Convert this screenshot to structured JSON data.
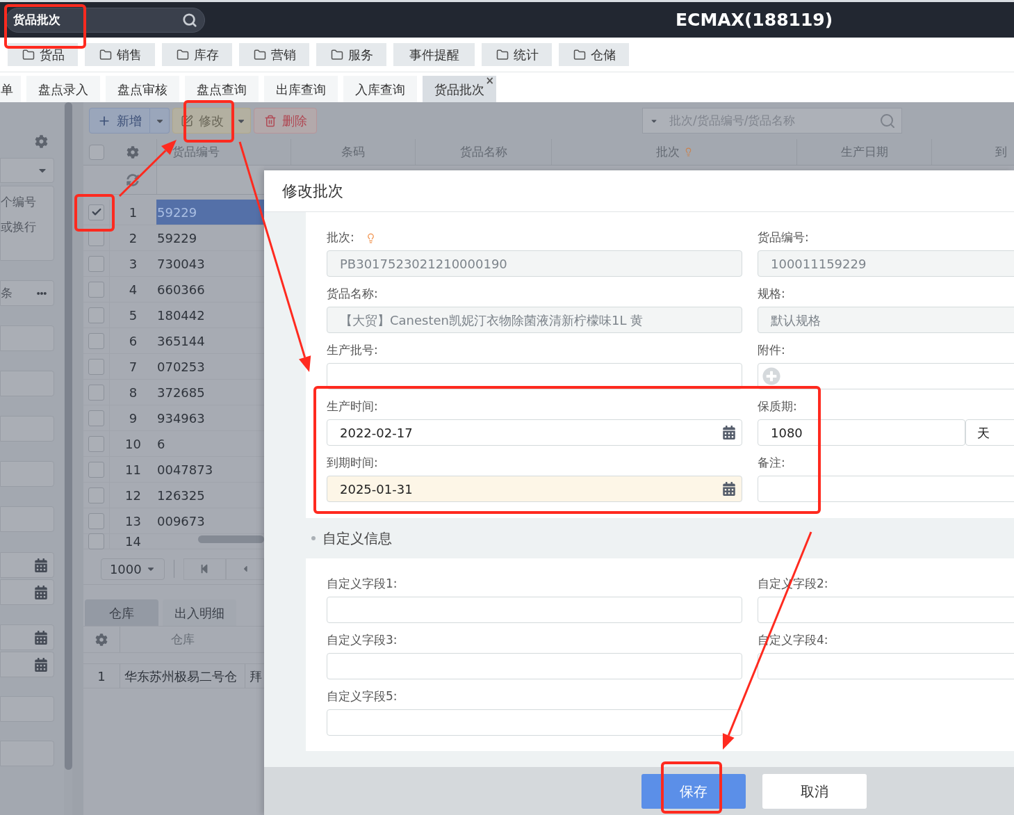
{
  "top_bar": {
    "search_value": "货品批次",
    "title": "ECMAX(188119)"
  },
  "menu": [
    {
      "label": "货品",
      "kind": "folder"
    },
    {
      "label": "销售",
      "kind": "folder"
    },
    {
      "label": "库存",
      "kind": "folder"
    },
    {
      "label": "营销",
      "kind": "folder"
    },
    {
      "label": "服务",
      "kind": "folder"
    },
    {
      "label": "事件提醒",
      "kind": "plain"
    },
    {
      "label": "统计",
      "kind": "folder"
    },
    {
      "label": "仓储",
      "kind": "folder"
    }
  ],
  "tabs": [
    {
      "label": "单",
      "selected": false
    },
    {
      "label": "盘点录入",
      "selected": false
    },
    {
      "label": "盘点审核",
      "selected": false
    },
    {
      "label": "盘点查询",
      "selected": false
    },
    {
      "label": "出库查询",
      "selected": false
    },
    {
      "label": "入库查询",
      "selected": false
    },
    {
      "label": "货品批次",
      "selected": true,
      "close": "×"
    }
  ],
  "filter_panel": {
    "fields": [
      {
        "kind": "select"
      },
      {
        "kind": "textarea",
        "lines": [
          "个编号",
          "或换行"
        ]
      },
      {
        "kind": "more",
        "placeholder": "条"
      },
      {
        "kind": "text"
      },
      {
        "kind": "text"
      },
      {
        "kind": "text"
      },
      {
        "kind": "text"
      },
      {
        "kind": "text"
      },
      {
        "kind": "date"
      },
      {
        "kind": "date"
      },
      {
        "kind": "date"
      },
      {
        "kind": "date"
      },
      {
        "kind": "text"
      },
      {
        "kind": "text"
      }
    ]
  },
  "toolbar": {
    "buttons": [
      {
        "label": "新增",
        "kind": "add",
        "dropdown": true
      },
      {
        "label": "修改",
        "kind": "edit",
        "dropdown": true
      },
      {
        "label": "删除",
        "kind": "delete",
        "dropdown": false
      }
    ],
    "search_placeholder": "批次/货品编号/货品名称"
  },
  "grid": {
    "columns": [
      {
        "label": "货品编号"
      },
      {
        "label": "条码"
      },
      {
        "label": "货品名称"
      },
      {
        "label": "批次",
        "hint": true
      },
      {
        "label": "生产日期"
      },
      {
        "label": "到"
      }
    ],
    "all_checked": false,
    "rows": [
      {
        "no": "1",
        "code": "59229",
        "checked": true,
        "selected": true
      },
      {
        "no": "2",
        "code": "59229",
        "checked": false,
        "selected": false
      },
      {
        "no": "3",
        "code": "730043",
        "checked": false,
        "selected": false
      },
      {
        "no": "4",
        "code": "660366",
        "checked": false,
        "selected": false
      },
      {
        "no": "5",
        "code": "180442",
        "checked": false,
        "selected": false
      },
      {
        "no": "6",
        "code": "365144",
        "checked": false,
        "selected": false
      },
      {
        "no": "7",
        "code": "070253",
        "checked": false,
        "selected": false
      },
      {
        "no": "8",
        "code": "372685",
        "checked": false,
        "selected": false
      },
      {
        "no": "9",
        "code": "934963",
        "checked": false,
        "selected": false
      },
      {
        "no": "10",
        "code": "6",
        "checked": false,
        "selected": false
      },
      {
        "no": "11",
        "code": "0047873",
        "checked": false,
        "selected": false
      },
      {
        "no": "12",
        "code": "126325",
        "checked": false,
        "selected": false
      },
      {
        "no": "13",
        "code": "009673",
        "checked": false,
        "selected": false
      },
      {
        "no": "14",
        "code": "",
        "checked": false,
        "selected": false
      }
    ],
    "page_size": "1000"
  },
  "detail_tabs": [
    {
      "label": "仓库",
      "selected": true
    },
    {
      "label": "出入明细",
      "selected": false
    }
  ],
  "detail_table": {
    "columns": [
      "仓库"
    ],
    "rows": [
      {
        "no": "1",
        "warehouse": "华东苏州极易二号仓",
        "column_3": "拜"
      }
    ]
  },
  "dialog": {
    "title": "修改批次",
    "fields": [
      {
        "label": "批次:",
        "kind": "readonly",
        "value": "PB3017523021210000190",
        "hint": true
      },
      {
        "label": "货品编号:",
        "kind": "readonly",
        "value": "100011159229"
      },
      {
        "label": "货品名称:",
        "kind": "readonly",
        "value": "【大贸】Canesten凯妮汀衣物除菌液清新柠檬味1L  黄"
      },
      {
        "label": "规格:",
        "kind": "readonly",
        "value": "默认规格"
      },
      {
        "label": "生产批号:",
        "kind": "text"
      },
      {
        "label": "附件:",
        "kind": "attachment"
      },
      {
        "label": "生产时间:",
        "kind": "date",
        "value": "2022-02-17",
        "highlighted": false
      },
      {
        "label": "保质期:",
        "kind": "period",
        "value": "1080",
        "unit": "天"
      },
      {
        "label": "到期时间:",
        "kind": "date",
        "value": "2025-01-31",
        "highlighted": true
      },
      {
        "label": "备注:",
        "kind": "text"
      }
    ],
    "section": "自定义信息",
    "custom_fields": [
      {
        "label": "自定义字段1:"
      },
      {
        "label": "自定义字段2:"
      },
      {
        "label": "自定义字段3:"
      },
      {
        "label": "自定义字段4:"
      },
      {
        "label": "自定义字段5:"
      }
    ],
    "buttons": [
      {
        "label": "保存",
        "kind": "primary"
      },
      {
        "label": "取消",
        "kind": "secondary"
      }
    ]
  }
}
